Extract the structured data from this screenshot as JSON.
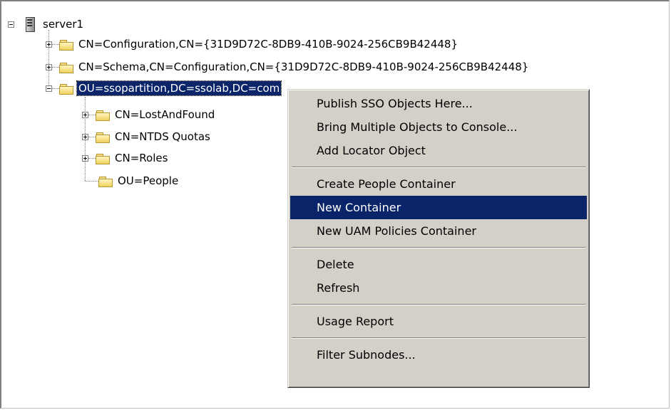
{
  "tree": {
    "root": {
      "label": "server1",
      "icon": "server-icon",
      "expanded": true
    },
    "children": [
      {
        "label": "CN=Configuration,CN={31D9D72C-8DB9-410B-9024-256CB9B42448}",
        "icon": "folder-icon",
        "expander": "plus"
      },
      {
        "label": "CN=Schema,CN=Configuration,CN={31D9D72C-8DB9-410B-9024-256CB9B42448}",
        "icon": "folder-icon",
        "expander": "plus"
      },
      {
        "label": "OU=ssopartition,DC=ssolab,DC=com",
        "icon": "folder-icon",
        "expander": "minus",
        "selected": true,
        "children": [
          {
            "label": "CN=LostAndFound",
            "icon": "folder-icon",
            "expander": "plus"
          },
          {
            "label": "CN=NTDS Quotas",
            "icon": "folder-icon",
            "expander": "plus"
          },
          {
            "label": "CN=Roles",
            "icon": "folder-icon",
            "expander": "plus"
          },
          {
            "label": "OU=People",
            "icon": "folder-icon",
            "expander": "none"
          }
        ]
      }
    ]
  },
  "context_menu": {
    "items": [
      {
        "label": "Publish SSO Objects Here..."
      },
      {
        "label": "Bring Multiple Objects to Console..."
      },
      {
        "label": "Add Locator Object"
      },
      {
        "label": "Create People Container"
      },
      {
        "label": "New Container",
        "highlighted": true
      },
      {
        "label": "New UAM Policies Container"
      },
      {
        "label": "Delete"
      },
      {
        "label": "Refresh"
      },
      {
        "label": "Usage Report"
      },
      {
        "label": "Filter Subnodes..."
      }
    ]
  },
  "colors": {
    "selection": "#0a246a",
    "menu_background": "#d4d0c8",
    "folder": "#f2d060"
  }
}
